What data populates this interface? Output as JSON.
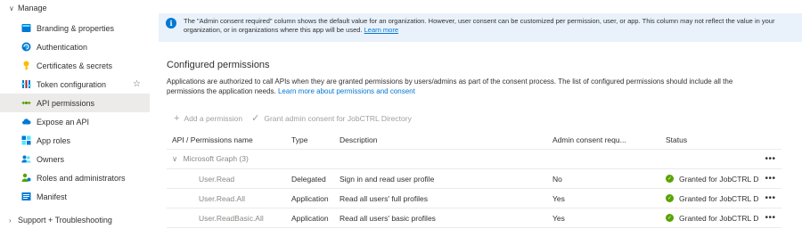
{
  "sidebar": {
    "group_manage": "Manage",
    "items": [
      {
        "label": "Branding & properties",
        "icon": "branding-icon"
      },
      {
        "label": "Authentication",
        "icon": "authentication-icon"
      },
      {
        "label": "Certificates & secrets",
        "icon": "key-icon"
      },
      {
        "label": "Token configuration",
        "icon": "token-bars-icon"
      },
      {
        "label": "API permissions",
        "icon": "api-arrows-icon"
      },
      {
        "label": "Expose an API",
        "icon": "cloud-icon"
      },
      {
        "label": "App roles",
        "icon": "app-roles-icon"
      },
      {
        "label": "Owners",
        "icon": "owners-icon"
      },
      {
        "label": "Roles and administrators",
        "icon": "roles-admin-icon"
      },
      {
        "label": "Manifest",
        "icon": "manifest-icon"
      }
    ],
    "group_support": "Support + Troubleshooting",
    "active_item": "API permissions"
  },
  "banner": {
    "text": "The \"Admin consent required\" column shows the default value for an organization. However, user consent can be customized per permission, user, or app. This column may not reflect the value in your organization, or in organizations where this app will be used.",
    "link": "Learn more"
  },
  "section": {
    "title": "Configured permissions",
    "description": "Applications are authorized to call APIs when they are granted permissions by users/admins as part of the consent process. The list of configured permissions should include all the permissions the application needs.",
    "description_link": "Learn more about permissions and consent"
  },
  "toolbar": {
    "add_permission": "Add a permission",
    "grant_consent": "Grant admin consent for JobCTRL Directory"
  },
  "table": {
    "headers": [
      "API / Permissions name",
      "Type",
      "Description",
      "Admin consent requ...",
      "Status"
    ],
    "group": "Microsoft Graph (3)",
    "rows": [
      {
        "name": "User.Read",
        "type": "Delegated",
        "description": "Sign in and read user profile",
        "admin_consent": "No",
        "status": "Granted for JobCTRL Dir..."
      },
      {
        "name": "User.Read.All",
        "type": "Application",
        "description": "Read all users' full profiles",
        "admin_consent": "Yes",
        "status": "Granted for JobCTRL Dir..."
      },
      {
        "name": "User.ReadBasic.All",
        "type": "Application",
        "description": "Read all users' basic profiles",
        "admin_consent": "Yes",
        "status": "Granted for JobCTRL Dir..."
      }
    ],
    "more": "•••"
  },
  "colors": {
    "accent": "#0078d4",
    "success": "#57a300",
    "banner_bg": "#e9f2fb",
    "active_bg": "#edebe9"
  }
}
